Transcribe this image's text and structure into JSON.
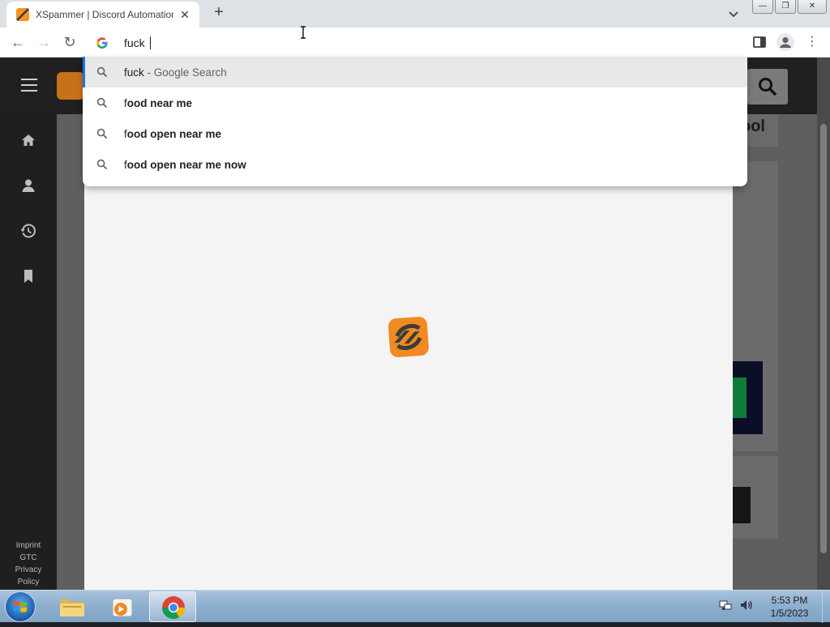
{
  "tab": {
    "title": "XSpammer | Discord Automation",
    "close_glyph": "✕",
    "new_tab_glyph": "+",
    "tab_search_glyph": "⌄"
  },
  "window": {
    "minimize_glyph": "—",
    "restore_glyph": "❐",
    "close_glyph": "✕"
  },
  "toolbar": {
    "back_glyph": "←",
    "forward_glyph": "→",
    "reload_glyph": "↻",
    "menu_glyph": "⋮"
  },
  "omnibox": {
    "typed_text": "fuck "
  },
  "suggestions": [
    {
      "prefix": "fuck",
      "bold": "",
      "suffix": " - Google Search",
      "selected": true
    },
    {
      "prefix": "f",
      "bold": "ood near me",
      "suffix": "",
      "selected": false
    },
    {
      "prefix": "f",
      "bold": "ood open near me",
      "suffix": "",
      "selected": false
    },
    {
      "prefix": "f",
      "bold": "ood open near me now",
      "suffix": "",
      "selected": false
    }
  ],
  "site": {
    "card_heading_fragment": "ool",
    "footer_links": [
      "Imprint",
      "GTC",
      "Privacy",
      "Policy"
    ]
  },
  "taskbar": {
    "time": "5:53 PM",
    "date": "1/5/2023"
  },
  "colors": {
    "accent_blue": "#1a73e8",
    "brand_orange": "#f18a21"
  }
}
